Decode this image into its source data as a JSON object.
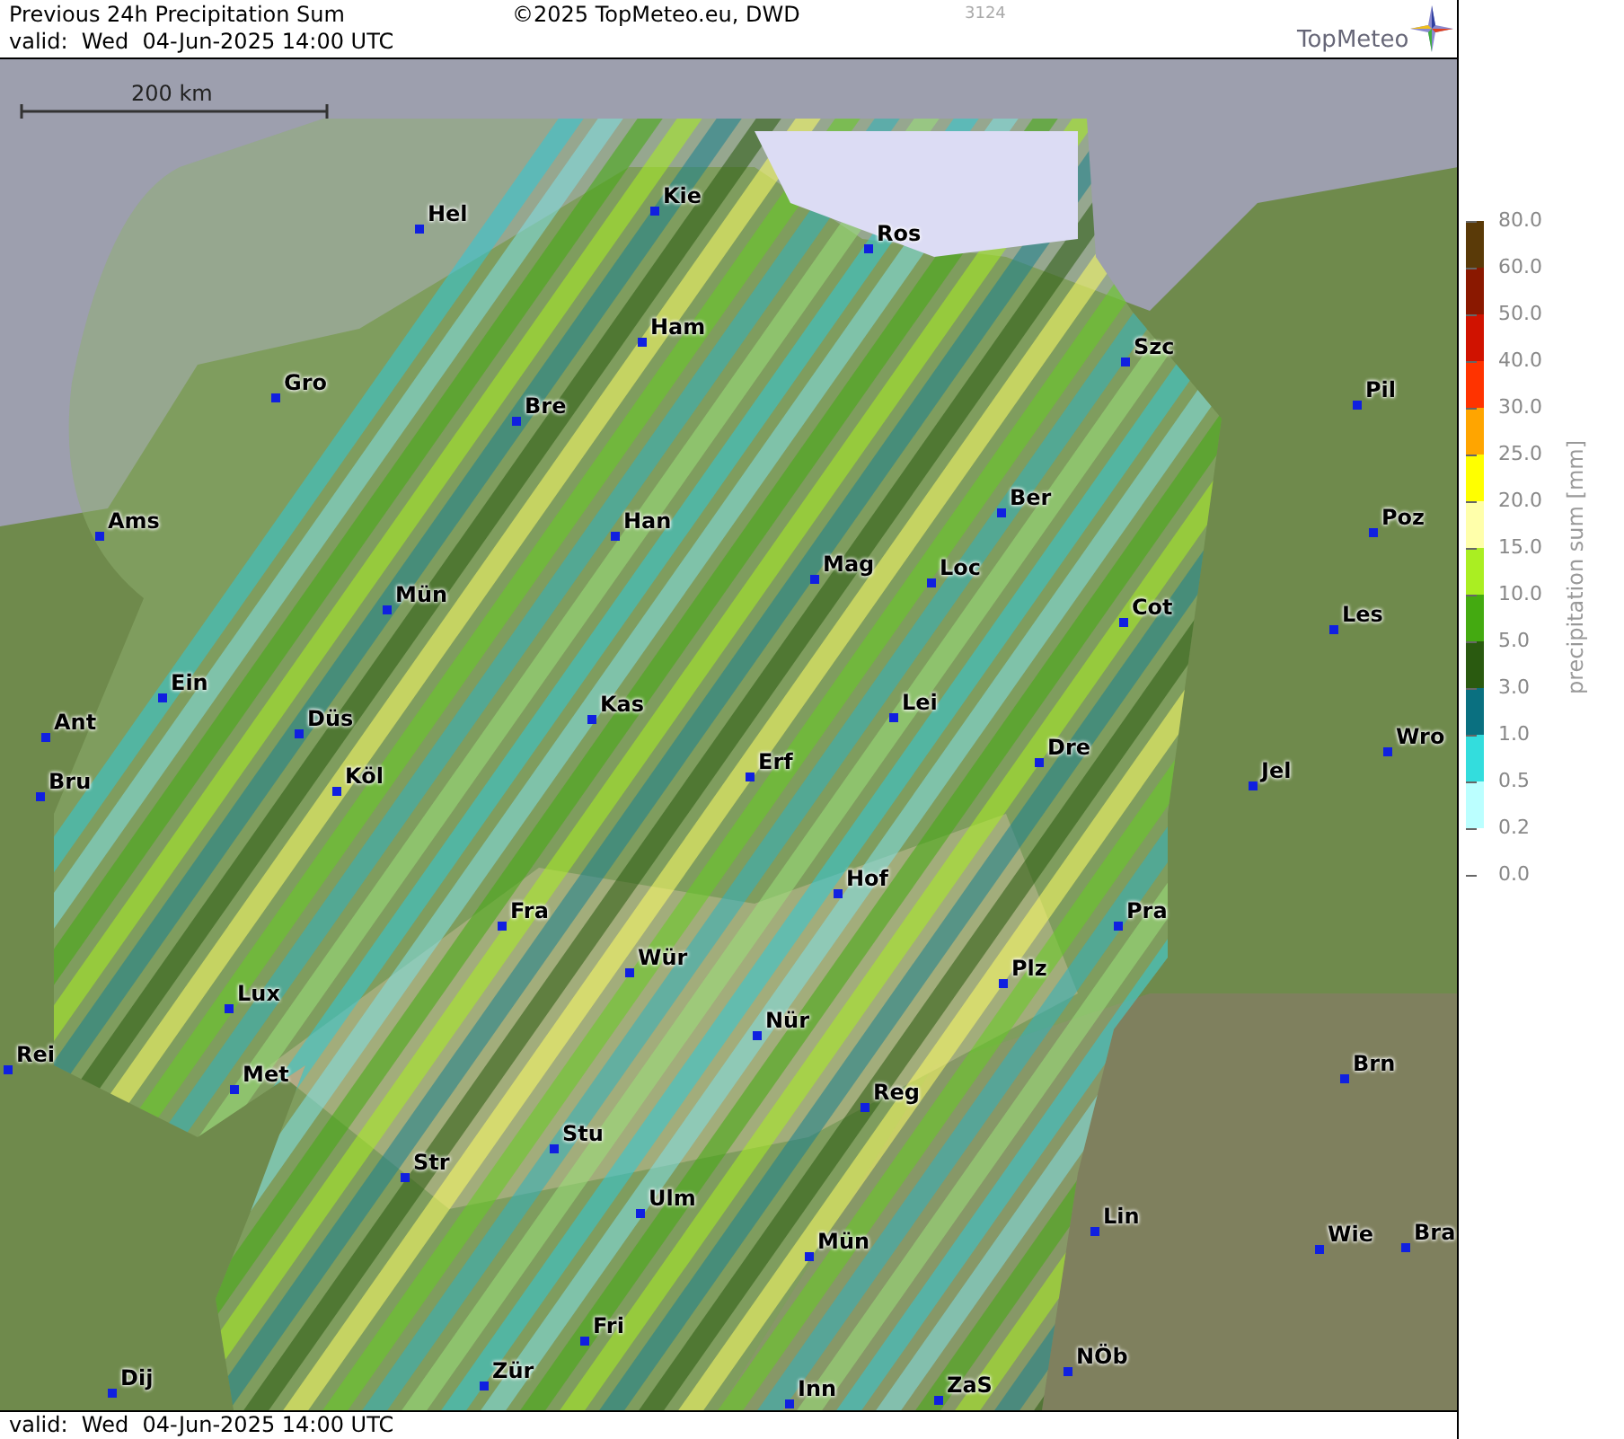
{
  "header": {
    "title": "Previous 24h Precipitation Sum",
    "valid": "valid:  Wed  04-Jun-2025 14:00 UTC",
    "copyright": "©2025 TopMeteo.eu, DWD",
    "code": "3124",
    "logo": "TopMeteo"
  },
  "map": {
    "scale_label": "200 km",
    "cities": [
      {
        "name": "Hel"
      },
      {
        "name": "Kie"
      },
      {
        "name": "Ros"
      },
      {
        "name": "Ham"
      },
      {
        "name": "Gro"
      },
      {
        "name": "Bre"
      },
      {
        "name": "Szc"
      },
      {
        "name": "Pil"
      },
      {
        "name": "Ams"
      },
      {
        "name": "Ber"
      },
      {
        "name": "Han"
      },
      {
        "name": "Poz"
      },
      {
        "name": "Mag"
      },
      {
        "name": "Loc"
      },
      {
        "name": "Mün"
      },
      {
        "name": "Cot"
      },
      {
        "name": "Les"
      },
      {
        "name": "Ein"
      },
      {
        "name": "Kas"
      },
      {
        "name": "Lei"
      },
      {
        "name": "Ant"
      },
      {
        "name": "Düs"
      },
      {
        "name": "Wro"
      },
      {
        "name": "Bru"
      },
      {
        "name": "Köl"
      },
      {
        "name": "Erf"
      },
      {
        "name": "Dre"
      },
      {
        "name": "Jel"
      },
      {
        "name": "Hof"
      },
      {
        "name": "Fra"
      },
      {
        "name": "Pra"
      },
      {
        "name": "Wür"
      },
      {
        "name": "Plz"
      },
      {
        "name": "Lux"
      },
      {
        "name": "Nür"
      },
      {
        "name": "Rei"
      },
      {
        "name": "Brn"
      },
      {
        "name": "Met"
      },
      {
        "name": "Reg"
      },
      {
        "name": "Stu"
      },
      {
        "name": "Str"
      },
      {
        "name": "Ulm"
      },
      {
        "name": "Lin"
      },
      {
        "name": "Wie"
      },
      {
        "name": "Bra"
      },
      {
        "name": "Mün"
      },
      {
        "name": "Fri"
      },
      {
        "name": "NÖb"
      },
      {
        "name": "Zür"
      },
      {
        "name": "Dij"
      },
      {
        "name": "Inn"
      },
      {
        "name": "ZaS"
      }
    ]
  },
  "legend": {
    "title": "precipitation sum [mm]",
    "ticks": [
      {
        "value": "80.0",
        "color": "#5a3a08"
      },
      {
        "value": "60.0",
        "color": "#8a1800"
      },
      {
        "value": "50.0",
        "color": "#d01200"
      },
      {
        "value": "40.0",
        "color": "#ff3300"
      },
      {
        "value": "30.0",
        "color": "#ffa500"
      },
      {
        "value": "25.0",
        "color": "#ffff00"
      },
      {
        "value": "20.0",
        "color": "#ffffaa"
      },
      {
        "value": "15.0",
        "color": "#aaee22"
      },
      {
        "value": "10.0",
        "color": "#44aa11"
      },
      {
        "value": "5.0",
        "color": "#2a5a10"
      },
      {
        "value": "3.0",
        "color": "#0a7080"
      },
      {
        "value": "1.0",
        "color": "#33dddd"
      },
      {
        "value": "0.5",
        "color": "#bbffff"
      },
      {
        "value": "0.2"
      },
      {
        "value": "0.0"
      }
    ]
  },
  "footer": {
    "valid": "valid:  Wed  04-Jun-2025 14:00 UTC"
  }
}
